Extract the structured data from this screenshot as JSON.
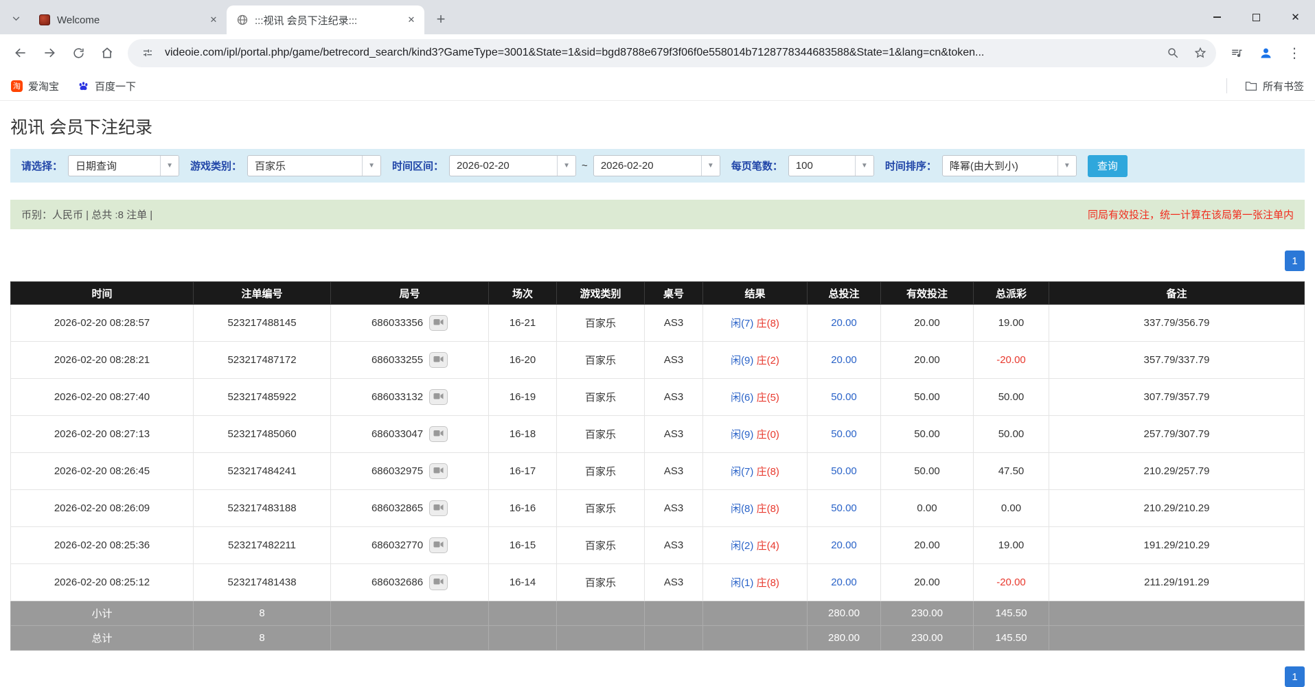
{
  "colors": {
    "link_blue": "#2a63c8",
    "negative_red": "#e8392e",
    "label_blue": "#2146a8",
    "filter_bg": "#d9edf6",
    "info_bg": "#dcead3",
    "info_red": "#f12c1e",
    "query_button_bg": "#2fa7dc",
    "pager_bg": "#2b78d7",
    "table_header_bg": "#1a1a1a",
    "summary_row_bg": "#9a9a9a"
  },
  "icons": {
    "close": "✕",
    "new_tab": "+",
    "dropdown_arrow": "▼",
    "menu_dots": "⋮"
  },
  "browser": {
    "tabs": [
      {
        "title": "Welcome"
      },
      {
        "title": ":::视讯 会员下注纪录:::"
      }
    ],
    "url": "videoie.com/ipl/portal.php/game/betrecord_search/kind3?GameType=3001&State=1&sid=bgd8788e679f3f06f0e558014b7128778344683588&State=1&lang=cn&token...",
    "bookmarks": [
      {
        "label": "爱淘宝",
        "badge": "淘"
      },
      {
        "label": "百度一下"
      }
    ],
    "all_bookmarks_label": "所有书签"
  },
  "page": {
    "title": "视讯 会员下注纪录",
    "filters": {
      "select_label": "请选择：",
      "select_value": "日期查询",
      "game_type_label": "游戏类别：",
      "game_type_value": "百家乐",
      "time_range_label": "时间区间：",
      "time_from": "2026-02-20",
      "tilde": "~",
      "time_to": "2026-02-20",
      "per_page_label": "每页笔数：",
      "per_page_value": "100",
      "sort_label": "时间排序：",
      "sort_value": "降幂(由大到小)",
      "search_button": "查询"
    },
    "info_bar": {
      "left": "币别：人民币 | 总共 :8 注单 |",
      "right": "同局有效投注，统一计算在该局第一张注单内"
    },
    "pagination": {
      "current": "1",
      "bottom": "1"
    },
    "table": {
      "headers": [
        "时间",
        "注单编号",
        "局号",
        "场次",
        "游戏类别",
        "桌号",
        "结果",
        "总投注",
        "有效投注",
        "总派彩",
        "备注"
      ],
      "rows": [
        {
          "time": "2026-02-20 08:28:57",
          "bet_id": "523217488145",
          "round": "686033356",
          "session": "16-21",
          "game": "百家乐",
          "table_no": "AS3",
          "result_player": "闲(7)",
          "result_banker": "庄(8)",
          "total_bet": "20.00",
          "valid_bet": "20.00",
          "payout": "19.00",
          "note": "337.79/356.79"
        },
        {
          "time": "2026-02-20 08:28:21",
          "bet_id": "523217487172",
          "round": "686033255",
          "session": "16-20",
          "game": "百家乐",
          "table_no": "AS3",
          "result_player": "闲(9)",
          "result_banker": "庄(2)",
          "total_bet": "20.00",
          "valid_bet": "20.00",
          "payout": "-20.00",
          "note": "357.79/337.79"
        },
        {
          "time": "2026-02-20 08:27:40",
          "bet_id": "523217485922",
          "round": "686033132",
          "session": "16-19",
          "game": "百家乐",
          "table_no": "AS3",
          "result_player": "闲(6)",
          "result_banker": "庄(5)",
          "total_bet": "50.00",
          "valid_bet": "50.00",
          "payout": "50.00",
          "note": "307.79/357.79"
        },
        {
          "time": "2026-02-20 08:27:13",
          "bet_id": "523217485060",
          "round": "686033047",
          "session": "16-18",
          "game": "百家乐",
          "table_no": "AS3",
          "result_player": "闲(9)",
          "result_banker": "庄(0)",
          "total_bet": "50.00",
          "valid_bet": "50.00",
          "payout": "50.00",
          "note": "257.79/307.79"
        },
        {
          "time": "2026-02-20 08:26:45",
          "bet_id": "523217484241",
          "round": "686032975",
          "session": "16-17",
          "game": "百家乐",
          "table_no": "AS3",
          "result_player": "闲(7)",
          "result_banker": "庄(8)",
          "total_bet": "50.00",
          "valid_bet": "50.00",
          "payout": "47.50",
          "note": "210.29/257.79"
        },
        {
          "time": "2026-02-20 08:26:09",
          "bet_id": "523217483188",
          "round": "686032865",
          "session": "16-16",
          "game": "百家乐",
          "table_no": "AS3",
          "result_player": "闲(8)",
          "result_banker": "庄(8)",
          "total_bet": "50.00",
          "valid_bet": "0.00",
          "payout": "0.00",
          "note": "210.29/210.29"
        },
        {
          "time": "2026-02-20 08:25:36",
          "bet_id": "523217482211",
          "round": "686032770",
          "session": "16-15",
          "game": "百家乐",
          "table_no": "AS3",
          "result_player": "闲(2)",
          "result_banker": "庄(4)",
          "total_bet": "20.00",
          "valid_bet": "20.00",
          "payout": "19.00",
          "note": "191.29/210.29"
        },
        {
          "time": "2026-02-20 08:25:12",
          "bet_id": "523217481438",
          "round": "686032686",
          "session": "16-14",
          "game": "百家乐",
          "table_no": "AS3",
          "result_player": "闲(1)",
          "result_banker": "庄(8)",
          "total_bet": "20.00",
          "valid_bet": "20.00",
          "payout": "-20.00",
          "note": "211.29/191.29"
        }
      ],
      "subtotal": {
        "label": "小计",
        "count": "8",
        "total_bet": "280.00",
        "valid_bet": "230.00",
        "payout": "145.50"
      },
      "total": {
        "label": "总计",
        "count": "8",
        "total_bet": "280.00",
        "valid_bet": "230.00",
        "payout": "145.50"
      }
    }
  }
}
